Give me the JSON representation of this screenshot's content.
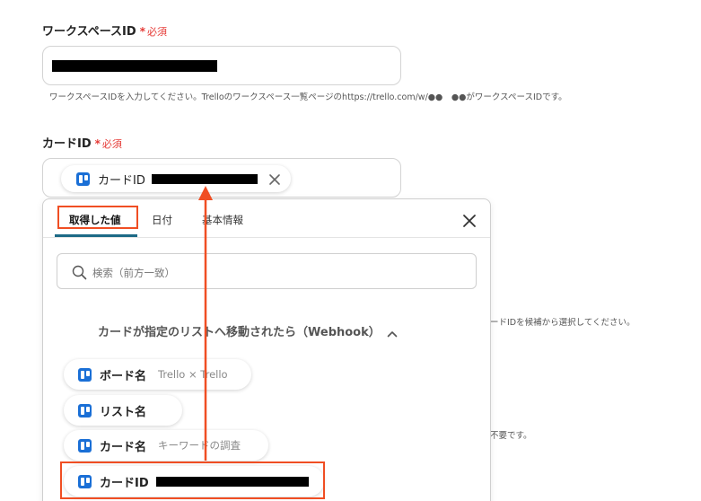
{
  "workspace_field": {
    "label": "ワークスペースID",
    "required_mark": "*",
    "required_text": "必須",
    "help": "ワークスペースIDを入力してください。Trelloのワークスペース一覧ページのhttps://trello.com/w/●●　●●がワークスペースIDです。"
  },
  "card_field": {
    "label": "カードID",
    "required_mark": "*",
    "required_text": "必須",
    "chip_label": "カードID",
    "remove_icon": "close-icon"
  },
  "background_text": {
    "hint_1": "ードIDを候補から選択してください。",
    "hint_2": "不要です。"
  },
  "panel": {
    "tabs": [
      "取得した値",
      "日付",
      "基本情報"
    ],
    "active_tab": 0,
    "close_icon": "close-icon",
    "search_placeholder": "検索（前方一致）",
    "section_title": "カードが指定のリストへ移動されたら（Webhook）",
    "section_toggle_icon": "chevron-up-icon",
    "items": [
      {
        "label": "ボード名",
        "value": "Trello × Trello"
      },
      {
        "label": "リスト名",
        "value": ""
      },
      {
        "label": "カード名",
        "value": "キーワードの調査"
      },
      {
        "label": "カードID",
        "value": ""
      }
    ]
  },
  "annotation": {
    "frame_color": "#f04e23",
    "arrow_color": "#f04e23"
  },
  "colors": {
    "required": "#e53935",
    "trello_blue": "#1a6fd6",
    "tab_underline": "#1d6a86"
  }
}
